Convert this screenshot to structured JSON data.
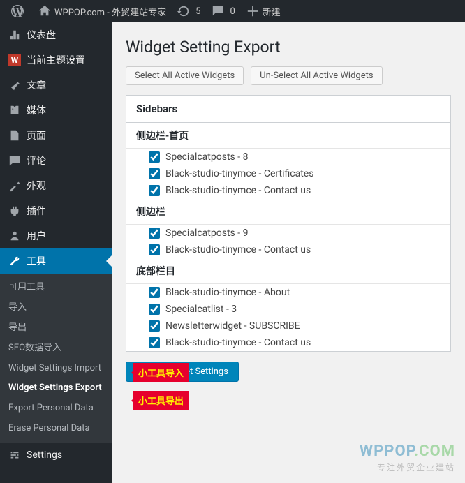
{
  "toolbar": {
    "site_title": "WPPOP.com - 外贸建站专家",
    "updates_count": "5",
    "comments_count": "0",
    "new_label": "新建"
  },
  "sidebar": {
    "items": [
      {
        "label": "仪表盘",
        "icon": "dashboard"
      },
      {
        "label": "当前主题设置",
        "icon": "wppop"
      },
      {
        "label": "文章",
        "icon": "pin"
      },
      {
        "label": "媒体",
        "icon": "media"
      },
      {
        "label": "页面",
        "icon": "page"
      },
      {
        "label": "评论",
        "icon": "comment"
      },
      {
        "label": "外观",
        "icon": "appearance"
      },
      {
        "label": "插件",
        "icon": "plugin"
      },
      {
        "label": "用户",
        "icon": "users"
      },
      {
        "label": "工具",
        "icon": "tools",
        "active": true
      },
      {
        "label": "Settings",
        "icon": "settings"
      }
    ],
    "submenu": [
      "可用工具",
      "导入",
      "导出",
      "SEO数据导入",
      "Widget Settings Import",
      "Widget Settings Export",
      "Export Personal Data",
      "Erase Personal Data"
    ],
    "submenu_current_index": 5
  },
  "page": {
    "title": "Widget Setting Export",
    "select_all": "Select All Active Widgets",
    "unselect_all": "Un-Select All Active Widgets",
    "panel_header": "Sidebars",
    "sections": [
      {
        "title": "侧边栏-首页",
        "widgets": [
          "Specialcatposts - 8",
          "Black-studio-tinymce - Certificates",
          "Black-studio-tinymce - Contact us"
        ]
      },
      {
        "title": "侧边栏",
        "widgets": [
          "Specialcatposts - 9",
          "Black-studio-tinymce - Contact us"
        ]
      },
      {
        "title": "底部栏目",
        "widgets": [
          "Black-studio-tinymce - About",
          "Specialcatlist - 3",
          "Newsletterwidget - SUBSCRIBE",
          "Black-studio-tinymce - Contact us"
        ]
      }
    ],
    "export_button": "Export Widget Settings"
  },
  "callouts": {
    "import": "小工具导入",
    "export": "小工具导出"
  },
  "watermark": {
    "logo_a": "WPPOP",
    "logo_b": ".COM",
    "tagline": "专注外贸企业建站"
  }
}
